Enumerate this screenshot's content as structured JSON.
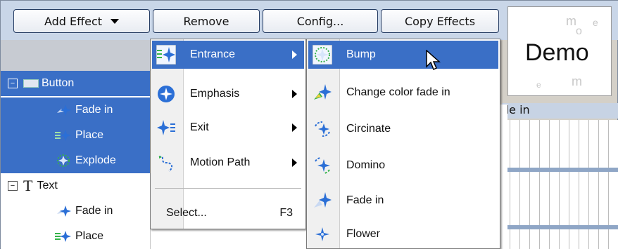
{
  "toolbar": {
    "add_effect": "Add Effect",
    "remove": "Remove",
    "config": "Config...",
    "copy_effects": "Copy Effects"
  },
  "demo": {
    "word": "Demo"
  },
  "tree": {
    "button_group": {
      "label": "Button",
      "expander": "−"
    },
    "button_children": [
      "Fade in",
      "Place",
      "Explode"
    ],
    "text_group": {
      "label": "Text",
      "expander": "−",
      "glyph": "T"
    },
    "text_children": [
      "Fade in",
      "Place"
    ]
  },
  "timeline": {
    "track_label": "de in"
  },
  "effect_menu": {
    "items": [
      {
        "label": "Entrance",
        "icon": "entrance-star-icon",
        "submenu": true
      },
      {
        "label": "Emphasis",
        "icon": "emphasis-star-icon",
        "submenu": true
      },
      {
        "label": "Exit",
        "icon": "exit-star-icon",
        "submenu": true
      },
      {
        "label": "Motion Path",
        "icon": "motion-path-icon",
        "submenu": true
      }
    ],
    "select": {
      "label": "Select...",
      "shortcut": "F3"
    }
  },
  "entrance_menu": {
    "items": [
      "Bump",
      "Change color fade in",
      "Circinate",
      "Domino",
      "Fade in",
      "Flower"
    ]
  },
  "colors": {
    "selection": "#3a6fc6",
    "toolbar": "#c9d6e8",
    "star_blue": "#2b6fd6",
    "star_green": "#35b34a"
  }
}
